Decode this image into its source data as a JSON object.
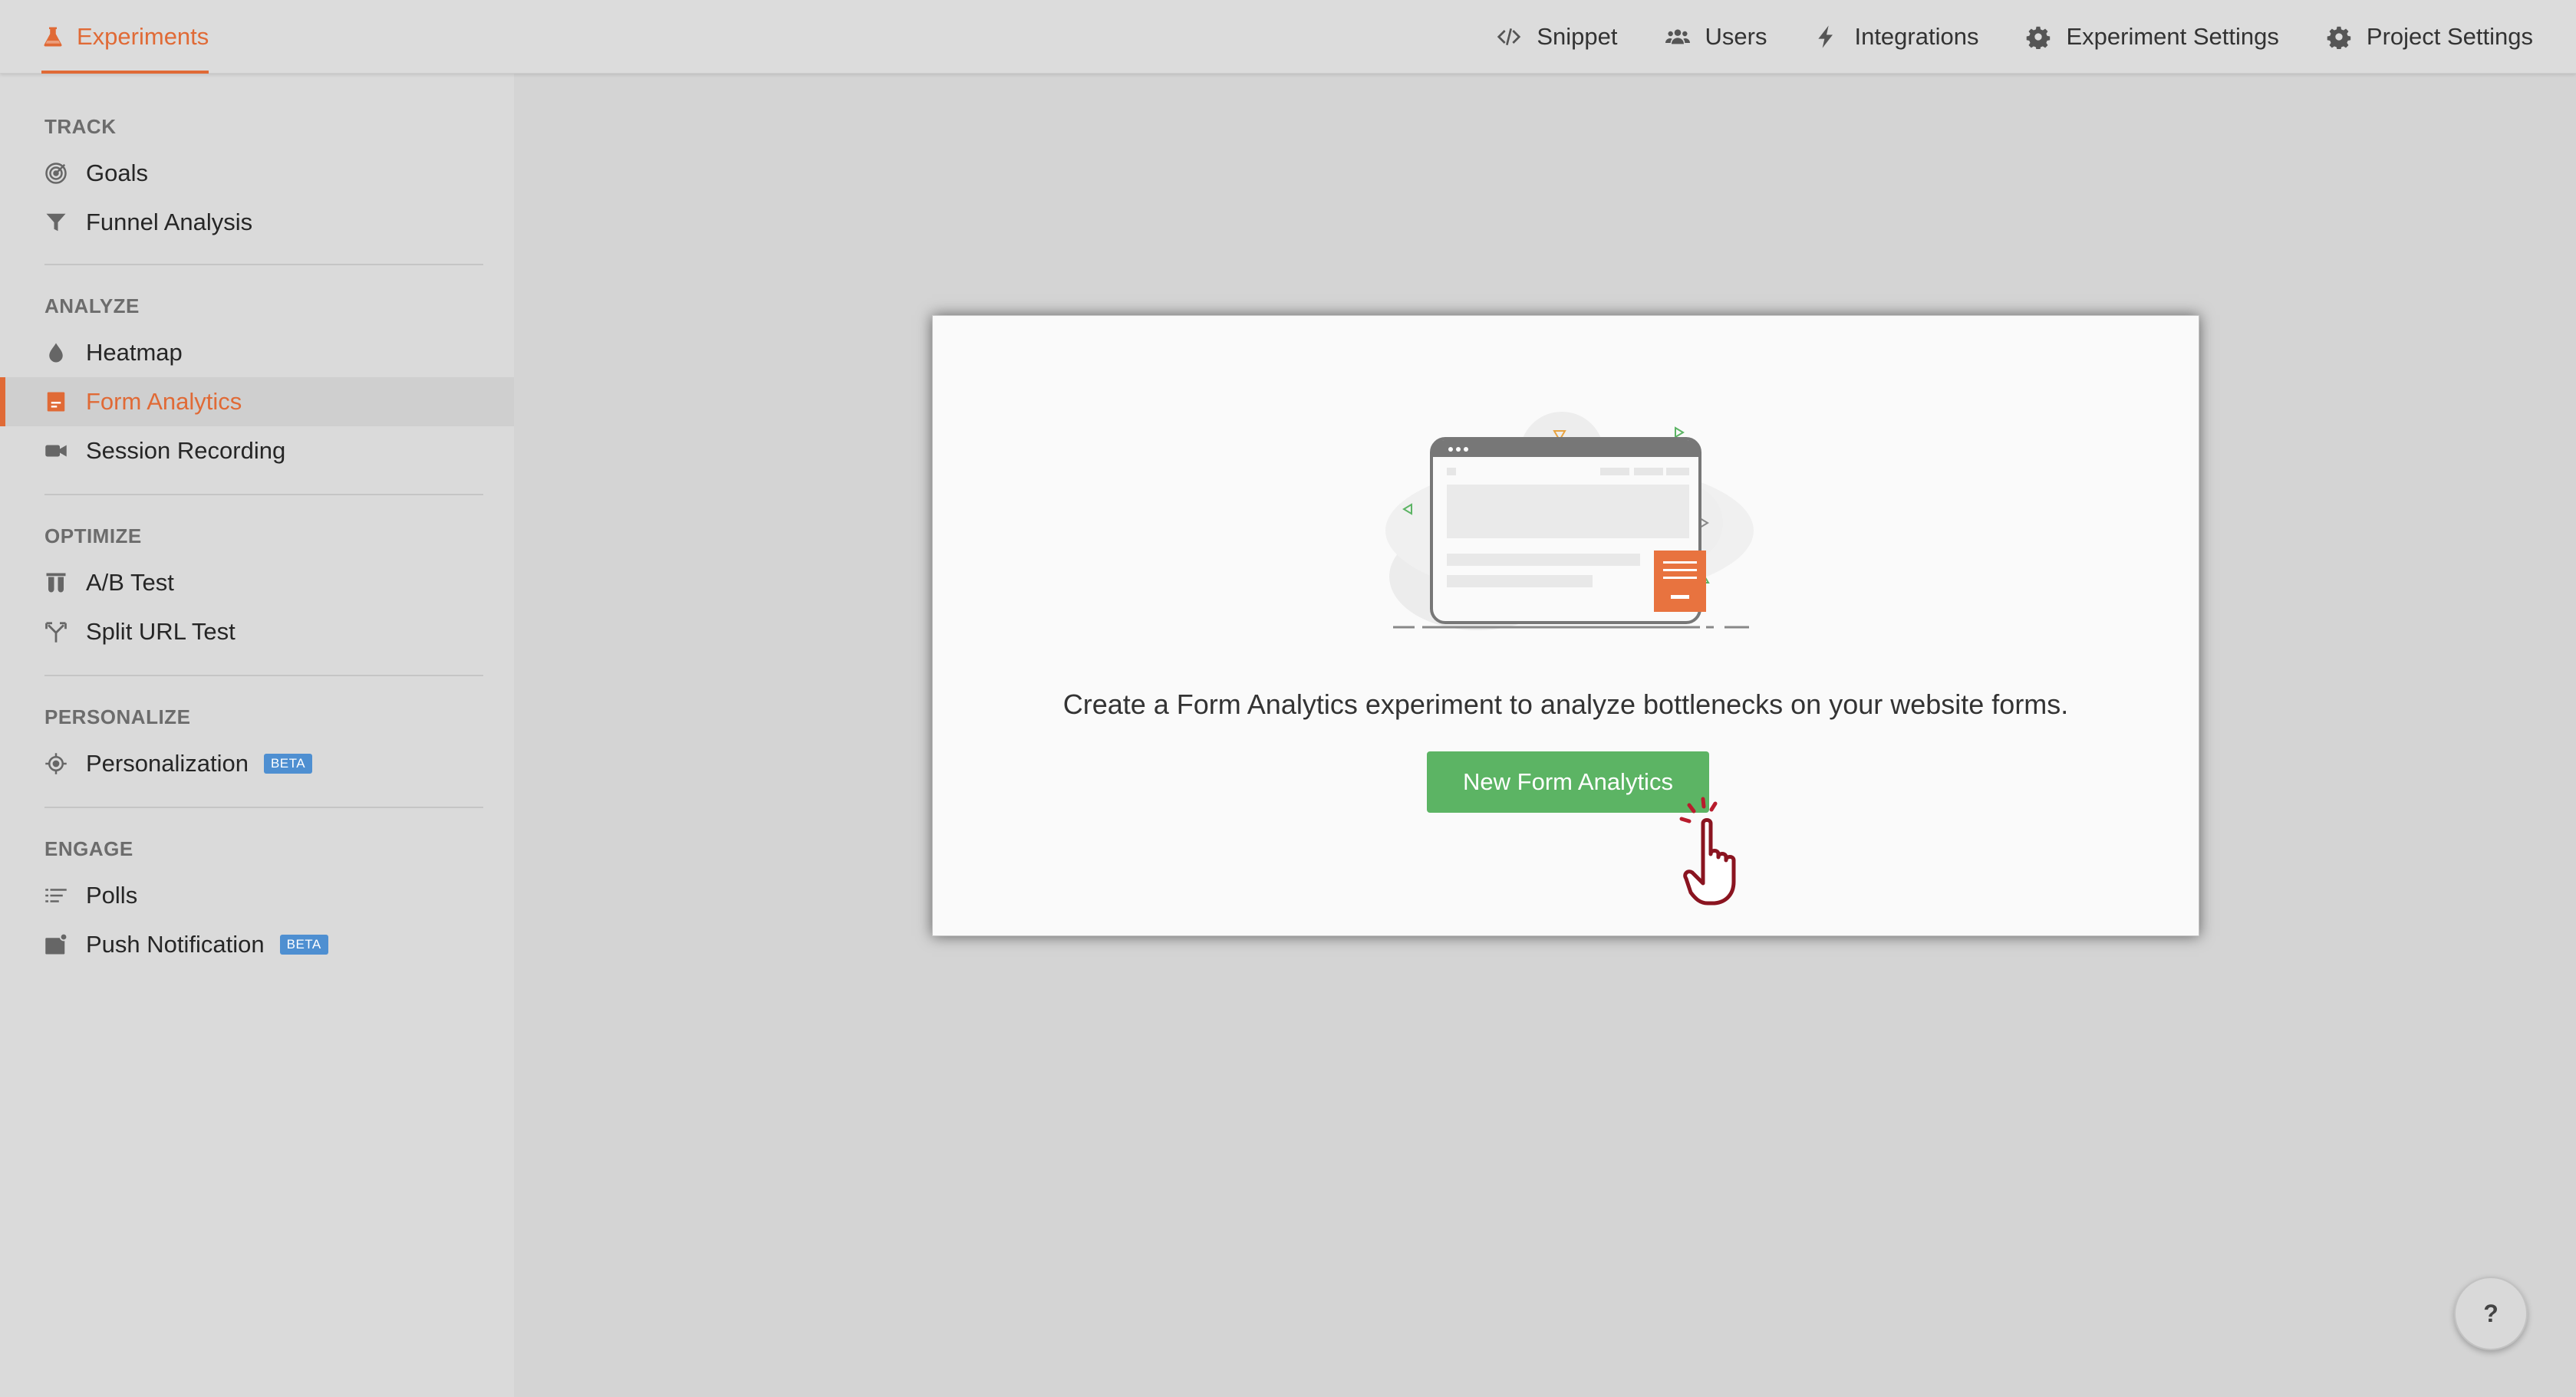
{
  "header": {
    "active_tab": "Experiments",
    "nav": [
      {
        "label": "Snippet",
        "icon": "code-icon"
      },
      {
        "label": "Users",
        "icon": "users-icon"
      },
      {
        "label": "Integrations",
        "icon": "lightning-icon"
      },
      {
        "label": "Experiment Settings",
        "icon": "gear-icon"
      },
      {
        "label": "Project Settings",
        "icon": "gear-icon"
      }
    ]
  },
  "sidebar": {
    "sections": [
      {
        "title": "TRACK",
        "items": [
          {
            "label": "Goals",
            "icon": "target-icon"
          },
          {
            "label": "Funnel Analysis",
            "icon": "funnel-icon"
          }
        ]
      },
      {
        "title": "ANALYZE",
        "items": [
          {
            "label": "Heatmap",
            "icon": "drop-icon"
          },
          {
            "label": "Form Analytics",
            "icon": "form-icon",
            "active": true
          },
          {
            "label": "Session Recording",
            "icon": "video-camera-icon"
          }
        ]
      },
      {
        "title": "OPTIMIZE",
        "items": [
          {
            "label": "A/B Test",
            "icon": "test-tubes-icon"
          },
          {
            "label": "Split URL Test",
            "icon": "split-icon"
          }
        ]
      },
      {
        "title": "PERSONALIZE",
        "items": [
          {
            "label": "Personalization",
            "icon": "crosshair-icon",
            "badge": "BETA"
          }
        ]
      },
      {
        "title": "ENGAGE",
        "items": [
          {
            "label": "Polls",
            "icon": "list-icon"
          },
          {
            "label": "Push Notification",
            "icon": "bell-box-icon",
            "badge": "BETA"
          }
        ]
      }
    ]
  },
  "main": {
    "message": "Create a Form Analytics experiment to analyze bottlenecks on your website forms.",
    "button_label": "New Form Analytics"
  },
  "help": {
    "label": "?"
  },
  "colors": {
    "accent": "#e06a36",
    "button": "#5cb464",
    "beta": "#4e8fd1"
  }
}
